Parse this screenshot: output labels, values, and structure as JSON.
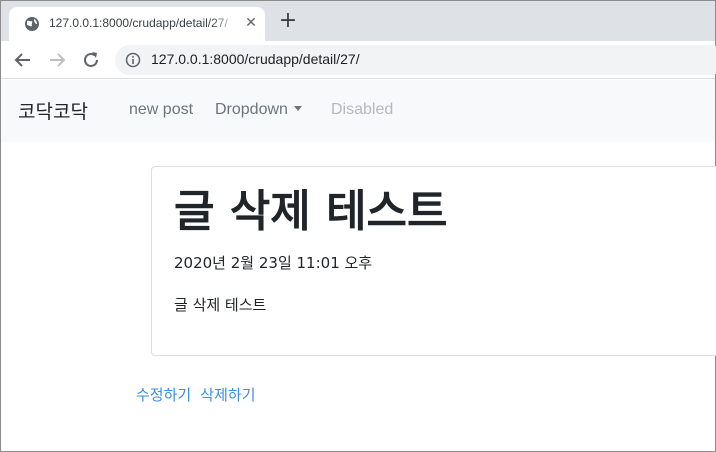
{
  "browser": {
    "tab_title": "127.0.0.1:8000/crudapp/detail/27/",
    "tab_close_glyph": "✕",
    "new_tab_glyph": "+",
    "url": "127.0.0.1:8000/crudapp/detail/27/",
    "icons": {
      "favicon": "globe-icon",
      "back": "arrow-left-icon",
      "forward": "arrow-right-icon",
      "reload": "reload-icon",
      "site_info": "info-icon"
    }
  },
  "navbar": {
    "brand": "코닥코닥",
    "links": {
      "new_post": "new post",
      "dropdown": "Dropdown",
      "disabled": "Disabled"
    }
  },
  "post": {
    "title": "글 삭제 테스트",
    "date": "2020년 2월 23일 11:01 오후",
    "body": "글 삭제 테스트"
  },
  "actions": {
    "edit": "수정하기",
    "delete": "삭제하기"
  },
  "colors": {
    "link": "#3d8ee0",
    "navbar_bg": "#f8f9fa",
    "tabstrip_bg": "#dee1e6"
  }
}
